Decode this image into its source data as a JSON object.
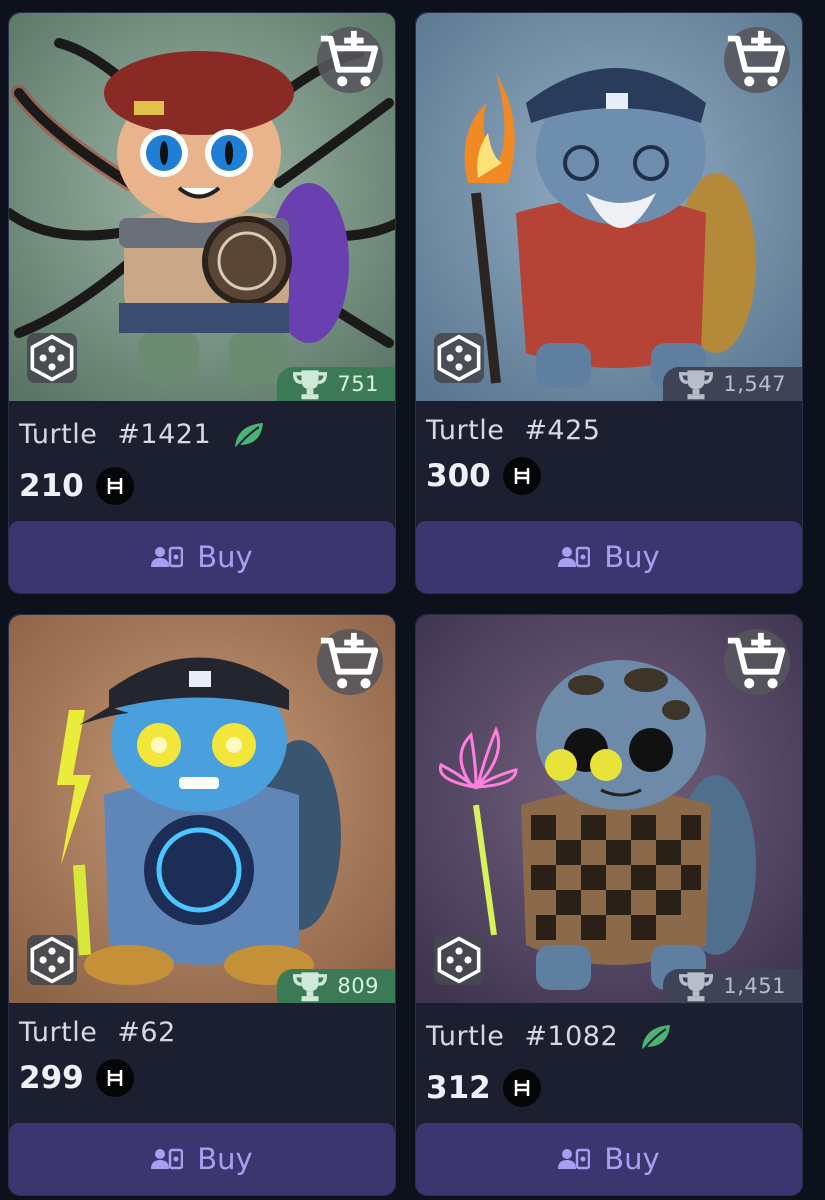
{
  "cards": [
    {
      "name_prefix": "Turtle",
      "number": "#1421",
      "price": "210",
      "rank": "751",
      "rank_color": "#3b7a55",
      "has_leaf": true,
      "buy_label": "Buy",
      "background": "#7e9a90",
      "icons": [
        "add-to-cart-icon",
        "cube-icon",
        "trophy-icon",
        "leaf-icon",
        "hbar-icon",
        "buy-user-icon"
      ]
    },
    {
      "name_prefix": "Turtle",
      "number": "#425",
      "price": "300",
      "rank": "1,547",
      "rank_color": "#3f4355",
      "has_leaf": false,
      "buy_label": "Buy",
      "background": "#6f8ea6"
    },
    {
      "name_prefix": "Turtle",
      "number": "#62",
      "price": "299",
      "rank": "809",
      "rank_color": "#3b7a55",
      "has_leaf": false,
      "buy_label": "Buy",
      "background": "#b0805e"
    },
    {
      "name_prefix": "Turtle",
      "number": "#1082",
      "price": "312",
      "rank": "1,451",
      "rank_color": "#3f4355",
      "has_leaf": true,
      "buy_label": "Buy",
      "background": "#5b4d6b"
    }
  ],
  "theme": {
    "page_bg": "#0d111c",
    "card_bg": "#1b1f30",
    "buy_bg": "#3b3570",
    "buy_text": "#a99ff0",
    "leaf_color": "#4bb374"
  }
}
